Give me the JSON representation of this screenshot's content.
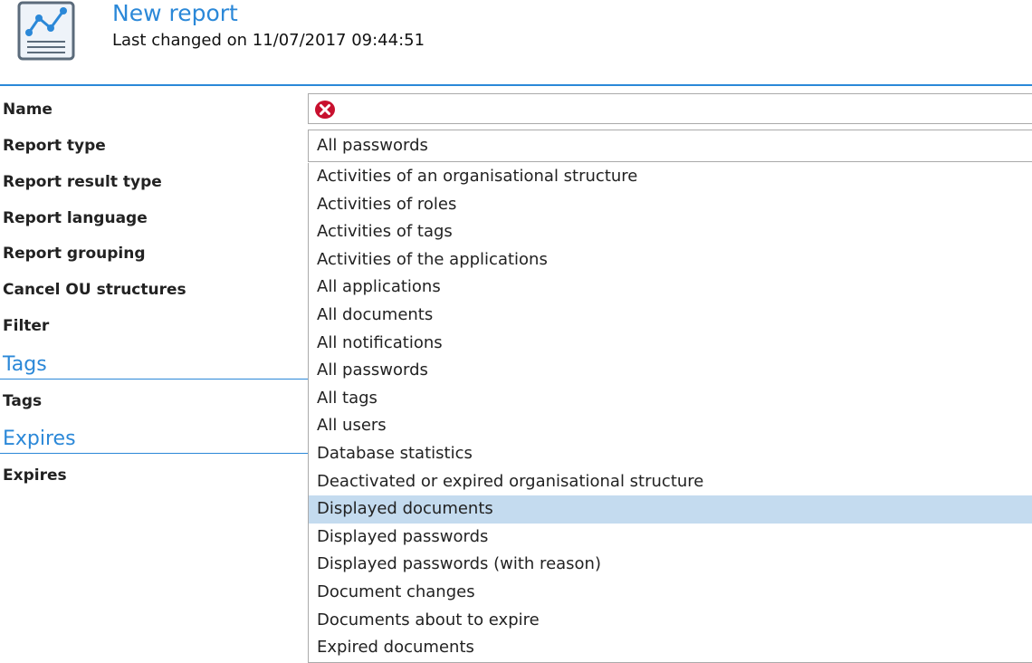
{
  "header": {
    "title": "New report",
    "subtitle": "Last changed on 11/07/2017 09:44:51",
    "icon": "report-chart-icon",
    "accent_color": "#2b88d8"
  },
  "form": {
    "labels": [
      "Name",
      "Report type",
      "Report result type",
      "Report language",
      "Report grouping",
      "Cancel OU structures",
      "Filter"
    ],
    "name_value": "",
    "name_error_icon": "error-icon",
    "report_type_value": "All passwords"
  },
  "sections": {
    "tags": {
      "title": "Tags",
      "label": "Tags"
    },
    "expires": {
      "title": "Expires",
      "label": "Expires"
    }
  },
  "dropdown": {
    "options": [
      "Activities of an organisational structure",
      "Activities of roles",
      "Activities of tags",
      "Activities of the applications",
      "All applications",
      "All documents",
      "All notifications",
      "All passwords",
      "All tags",
      "All users",
      "Database statistics",
      "Deactivated or expired organisational structure",
      "Displayed documents",
      "Displayed passwords",
      "Displayed passwords (with reason)",
      "Document changes",
      "Documents about to expire",
      "Expired documents"
    ],
    "hovered_option": "Displayed documents",
    "hover_color": "#c4dbef"
  }
}
